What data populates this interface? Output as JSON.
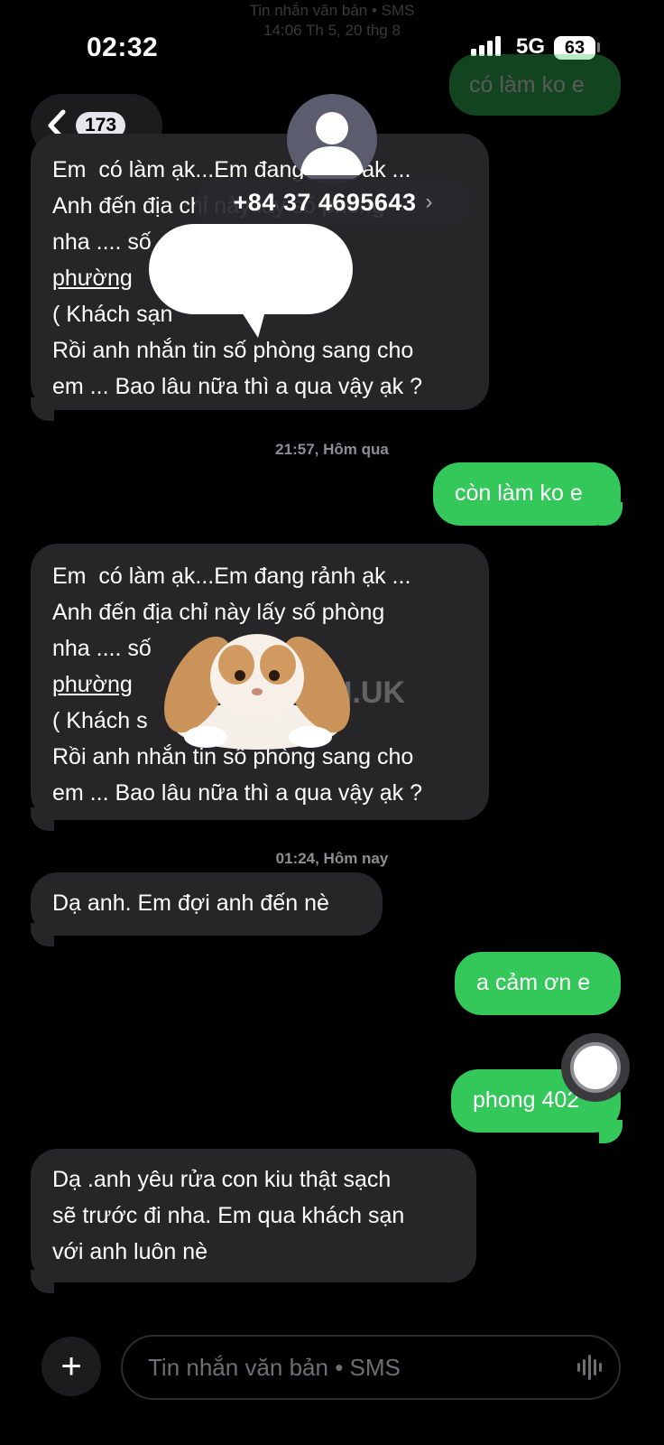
{
  "header_hint": {
    "line1": "Tin nhắn văn bản • SMS",
    "line2": "14:06 Th 5, 20 thg 8"
  },
  "status_bar": {
    "time": "02:32",
    "network": "5G",
    "battery": "63"
  },
  "nav": {
    "unread_count": "173",
    "contact_number": "+84 37 4695643",
    "contact_chevron": "›"
  },
  "messages": [
    {
      "direction": "outgoing",
      "text": "có làm ko e",
      "faded": true
    },
    {
      "direction": "incoming",
      "lines": [
        "Em  có làm ạk...Em đang rảnh ak ...",
        "Anh đến địa chỉ này lấy số phòng",
        "nha .... số",
        "phường",
        "( Khách sạn",
        "Rồi anh nhắn tin số phòng sang cho",
        "em ... Bao lâu nữa thì a qua vậy ạk ?"
      ]
    },
    {
      "timestamp": "21:57, Hôm qua"
    },
    {
      "direction": "outgoing",
      "text": "còn làm ko e"
    },
    {
      "direction": "incoming",
      "lines": [
        "Em  có làm ạk...Em đang rảnh ạk ...",
        "Anh đến địa chỉ này lấy số phòng",
        "nha .... số",
        "phường",
        "( Khách s",
        "Rồi anh nhắn tin số phòng sang cho",
        "em ... Bao lâu nữa thì a qua vậy ạk ?"
      ]
    },
    {
      "timestamp": "01:24, Hôm nay"
    },
    {
      "direction": "incoming",
      "text": "Dạ anh. Em đợi anh đến nè"
    },
    {
      "direction": "outgoing",
      "text": "a cảm ơn e"
    },
    {
      "direction": "outgoing",
      "text": "phong 402"
    },
    {
      "direction": "incoming",
      "lines": [
        "Dạ .anh yêu rửa con kiu thật sạch",
        "sẽ trước đi nha. Em qua khách sạn",
        "với anh luôn nè"
      ]
    }
  ],
  "watermark": "HOI.UK",
  "composer": {
    "placeholder": "Tin nhắn văn bản • SMS",
    "plus_label": "+"
  },
  "icons": {
    "back": "chevron-left-icon",
    "avatar": "person-icon",
    "record": "record-button-icon",
    "mic": "waveform-icon"
  },
  "colors": {
    "incoming_bubble": "#262628",
    "outgoing_bubble": "#34c759",
    "background": "#000000"
  }
}
